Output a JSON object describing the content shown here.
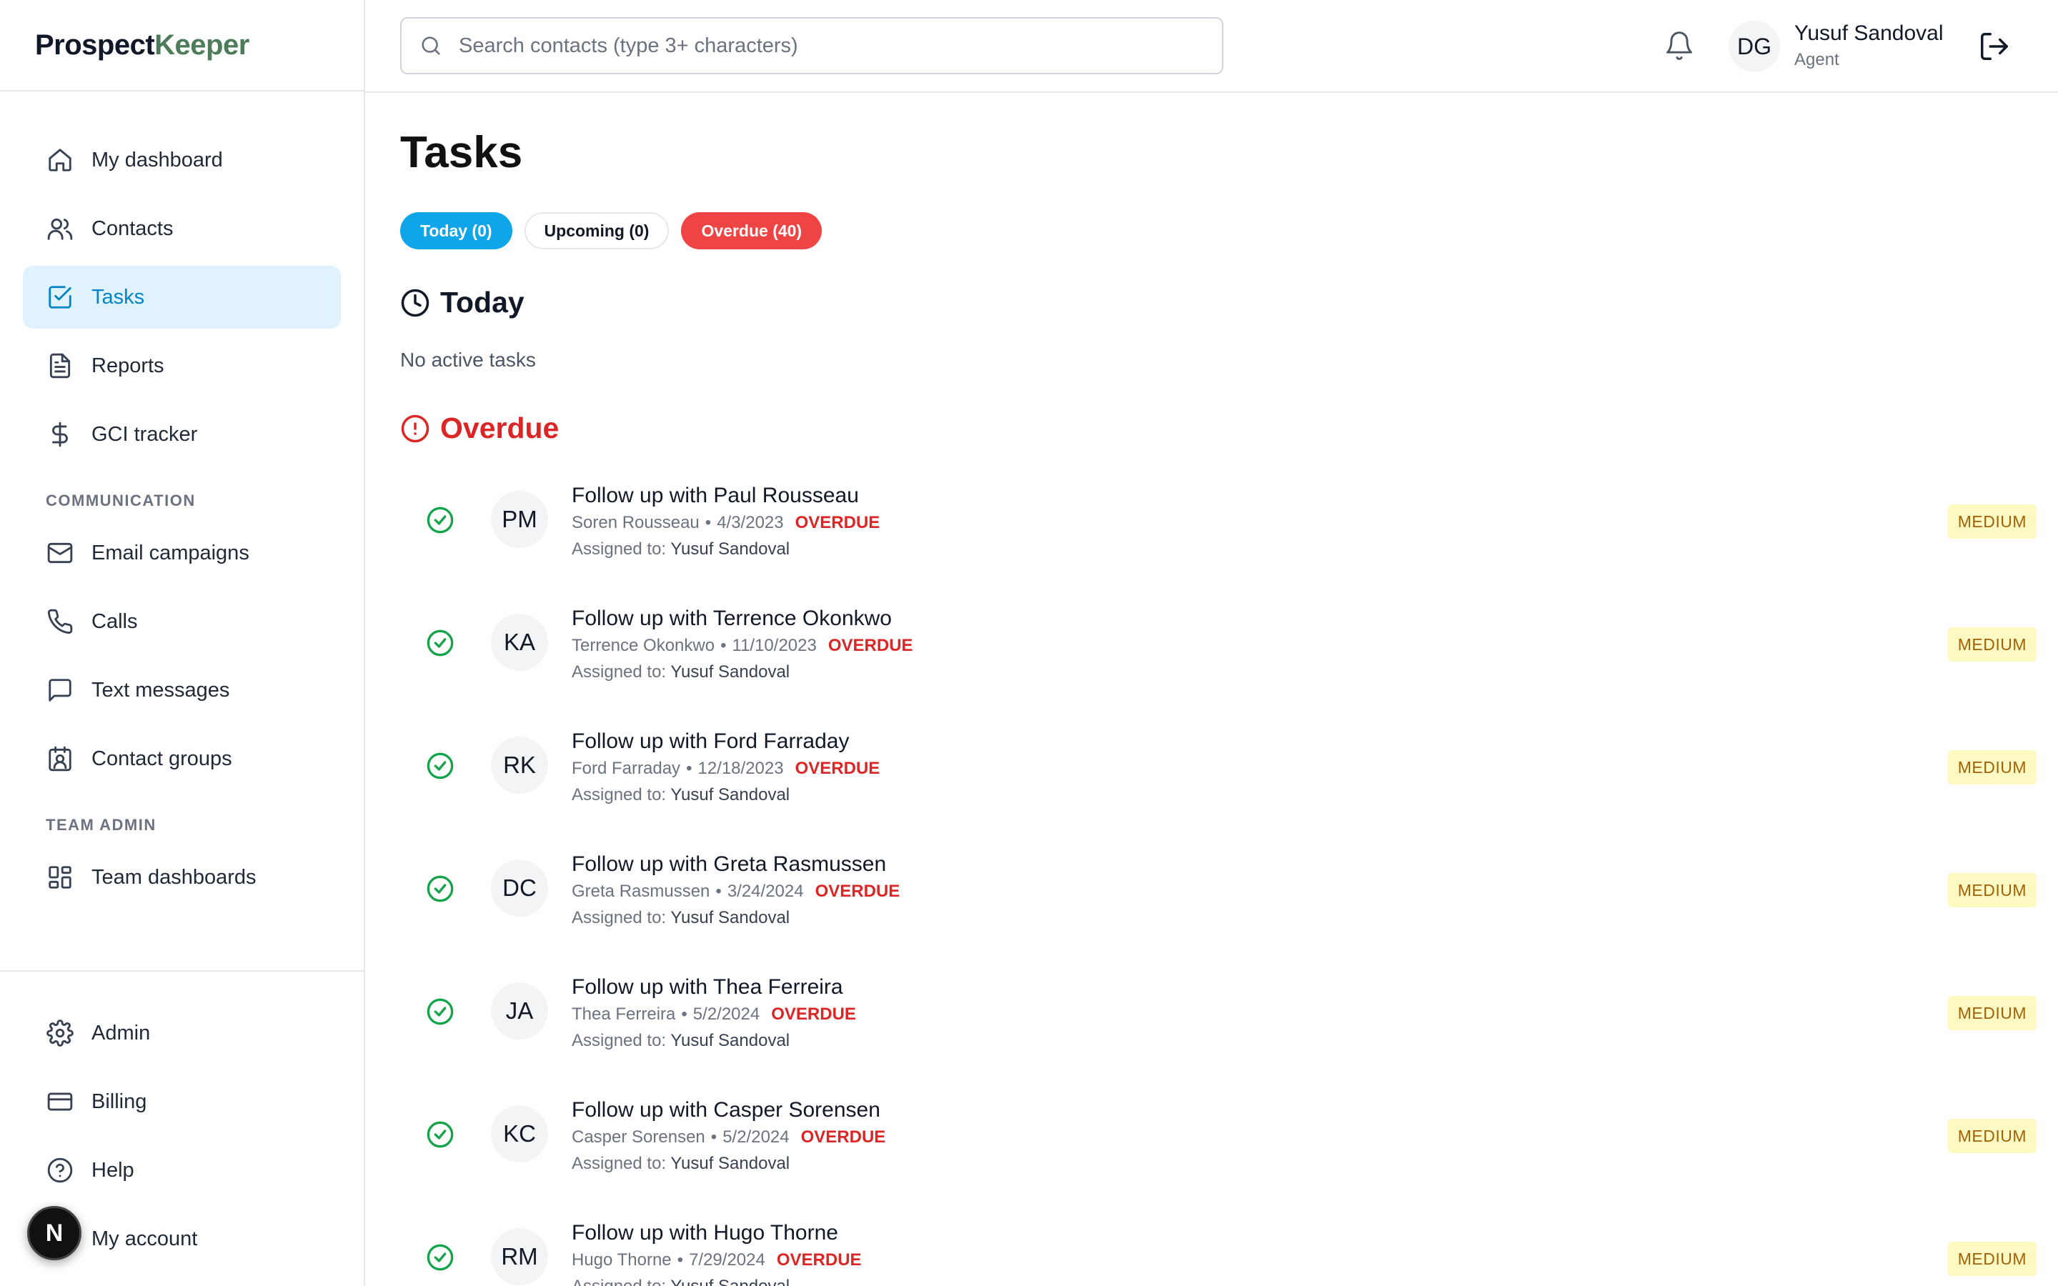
{
  "app": {
    "logo_part1": "Prospect",
    "logo_part2": "Keeper"
  },
  "sidebar": {
    "items": [
      {
        "label": "My dashboard",
        "icon": "home-icon"
      },
      {
        "label": "Contacts",
        "icon": "users-icon"
      },
      {
        "label": "Tasks",
        "icon": "check-square-icon",
        "active": true
      },
      {
        "label": "Reports",
        "icon": "file-text-icon"
      },
      {
        "label": "GCI tracker",
        "icon": "dollar-icon"
      }
    ],
    "section_communication": "COMMUNICATION",
    "communication_items": [
      {
        "label": "Email campaigns",
        "icon": "mail-icon"
      },
      {
        "label": "Calls",
        "icon": "phone-icon"
      },
      {
        "label": "Text messages",
        "icon": "message-icon"
      },
      {
        "label": "Contact groups",
        "icon": "contact-group-icon"
      }
    ],
    "section_team_admin": "TEAM ADMIN",
    "team_items": [
      {
        "label": "Team dashboards",
        "icon": "dashboard-grid-icon"
      }
    ],
    "bottom_items": [
      {
        "label": "Admin",
        "icon": "gear-icon"
      },
      {
        "label": "Billing",
        "icon": "credit-card-icon"
      },
      {
        "label": "Help",
        "icon": "help-circle-icon"
      },
      {
        "label": "My account",
        "icon": "user-icon"
      }
    ],
    "fab_letter": "N"
  },
  "header": {
    "search_placeholder": "Search contacts (type 3+ characters)",
    "avatar_initials": "DG",
    "user_name": "Yusuf Sandoval",
    "user_role": "Agent"
  },
  "main": {
    "title": "Tasks",
    "tabs": {
      "today": "Today (0)",
      "upcoming": "Upcoming (0)",
      "overdue": "Overdue (40)"
    },
    "today_heading": "Today",
    "today_empty": "No active tasks",
    "overdue_heading": "Overdue",
    "overdue_label": "OVERDUE",
    "assigned_prefix": "Assigned to:",
    "tasks": [
      {
        "initials": "PM",
        "title": "Follow up with Paul Rousseau",
        "contact": "Soren Rousseau",
        "date": "4/3/2023",
        "assignee": "Yusuf Sandoval",
        "priority": "MEDIUM"
      },
      {
        "initials": "KA",
        "title": "Follow up with Terrence Okonkwo",
        "contact": "Terrence Okonkwo",
        "date": "11/10/2023",
        "assignee": "Yusuf Sandoval",
        "priority": "MEDIUM"
      },
      {
        "initials": "RK",
        "title": "Follow up with Ford Farraday",
        "contact": "Ford Farraday",
        "date": "12/18/2023",
        "assignee": "Yusuf Sandoval",
        "priority": "MEDIUM"
      },
      {
        "initials": "DC",
        "title": "Follow up with Greta Rasmussen",
        "contact": "Greta Rasmussen",
        "date": "3/24/2024",
        "assignee": "Yusuf Sandoval",
        "priority": "MEDIUM"
      },
      {
        "initials": "JA",
        "title": "Follow up with Thea Ferreira",
        "contact": "Thea Ferreira",
        "date": "5/2/2024",
        "assignee": "Yusuf Sandoval",
        "priority": "MEDIUM"
      },
      {
        "initials": "KC",
        "title": "Follow up with Casper Sorensen",
        "contact": "Casper Sorensen",
        "date": "5/2/2024",
        "assignee": "Yusuf Sandoval",
        "priority": "MEDIUM"
      },
      {
        "initials": "RM",
        "title": "Follow up with Hugo Thorne",
        "contact": "Hugo Thorne",
        "date": "7/29/2024",
        "assignee": "Yusuf Sandoval",
        "priority": "MEDIUM"
      }
    ]
  },
  "colors": {
    "accent": "#0ea5e9",
    "danger": "#dc2626",
    "success": "#16a34a",
    "priority_bg": "#fef9c3",
    "priority_text": "#a16207",
    "logo_green": "#4d7c5a"
  }
}
